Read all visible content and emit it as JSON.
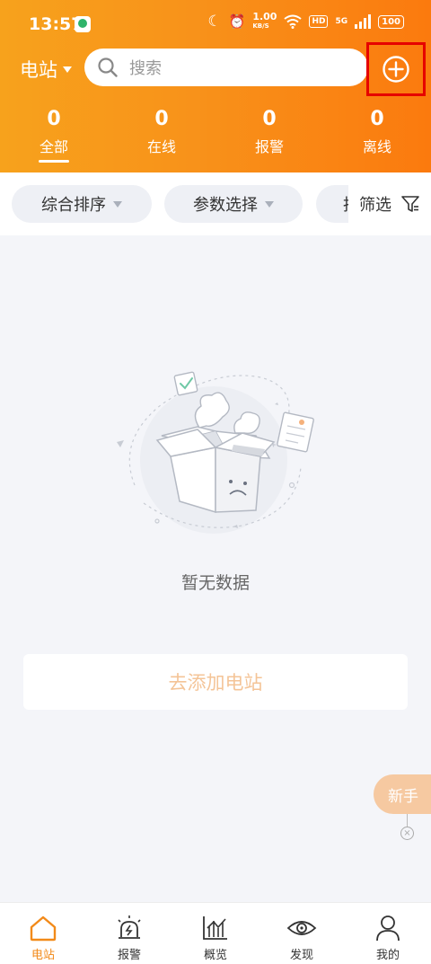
{
  "status_bar": {
    "time": "13:57",
    "speed_value": "1.00",
    "speed_unit": "KB/S",
    "hd": "HD",
    "network": "5G",
    "battery": "100"
  },
  "header": {
    "station_label": "电站",
    "search_placeholder": "搜索"
  },
  "stats": [
    {
      "count": "0",
      "label": "全部"
    },
    {
      "count": "0",
      "label": "在线"
    },
    {
      "count": "0",
      "label": "报警"
    },
    {
      "count": "0",
      "label": "离线"
    }
  ],
  "filters": {
    "sort_label": "综合排序",
    "param_label": "参数选择",
    "partial_label": "拍",
    "filter_label": "筛选"
  },
  "empty": {
    "text": "暂无数据",
    "add_button": "去添加电站"
  },
  "guide": {
    "label": "新手",
    "close": "×"
  },
  "tabbar": [
    {
      "label": "电站",
      "icon": "home-icon"
    },
    {
      "label": "报警",
      "icon": "alarm-light-icon"
    },
    {
      "label": "概览",
      "icon": "chart-icon"
    },
    {
      "label": "发现",
      "icon": "eye-icon"
    },
    {
      "label": "我的",
      "icon": "user-icon"
    }
  ],
  "colors": {
    "header_start": "#f7a21c",
    "header_end": "#fb7a0e",
    "accent": "#f28a19",
    "highlight_box": "#e60000"
  }
}
